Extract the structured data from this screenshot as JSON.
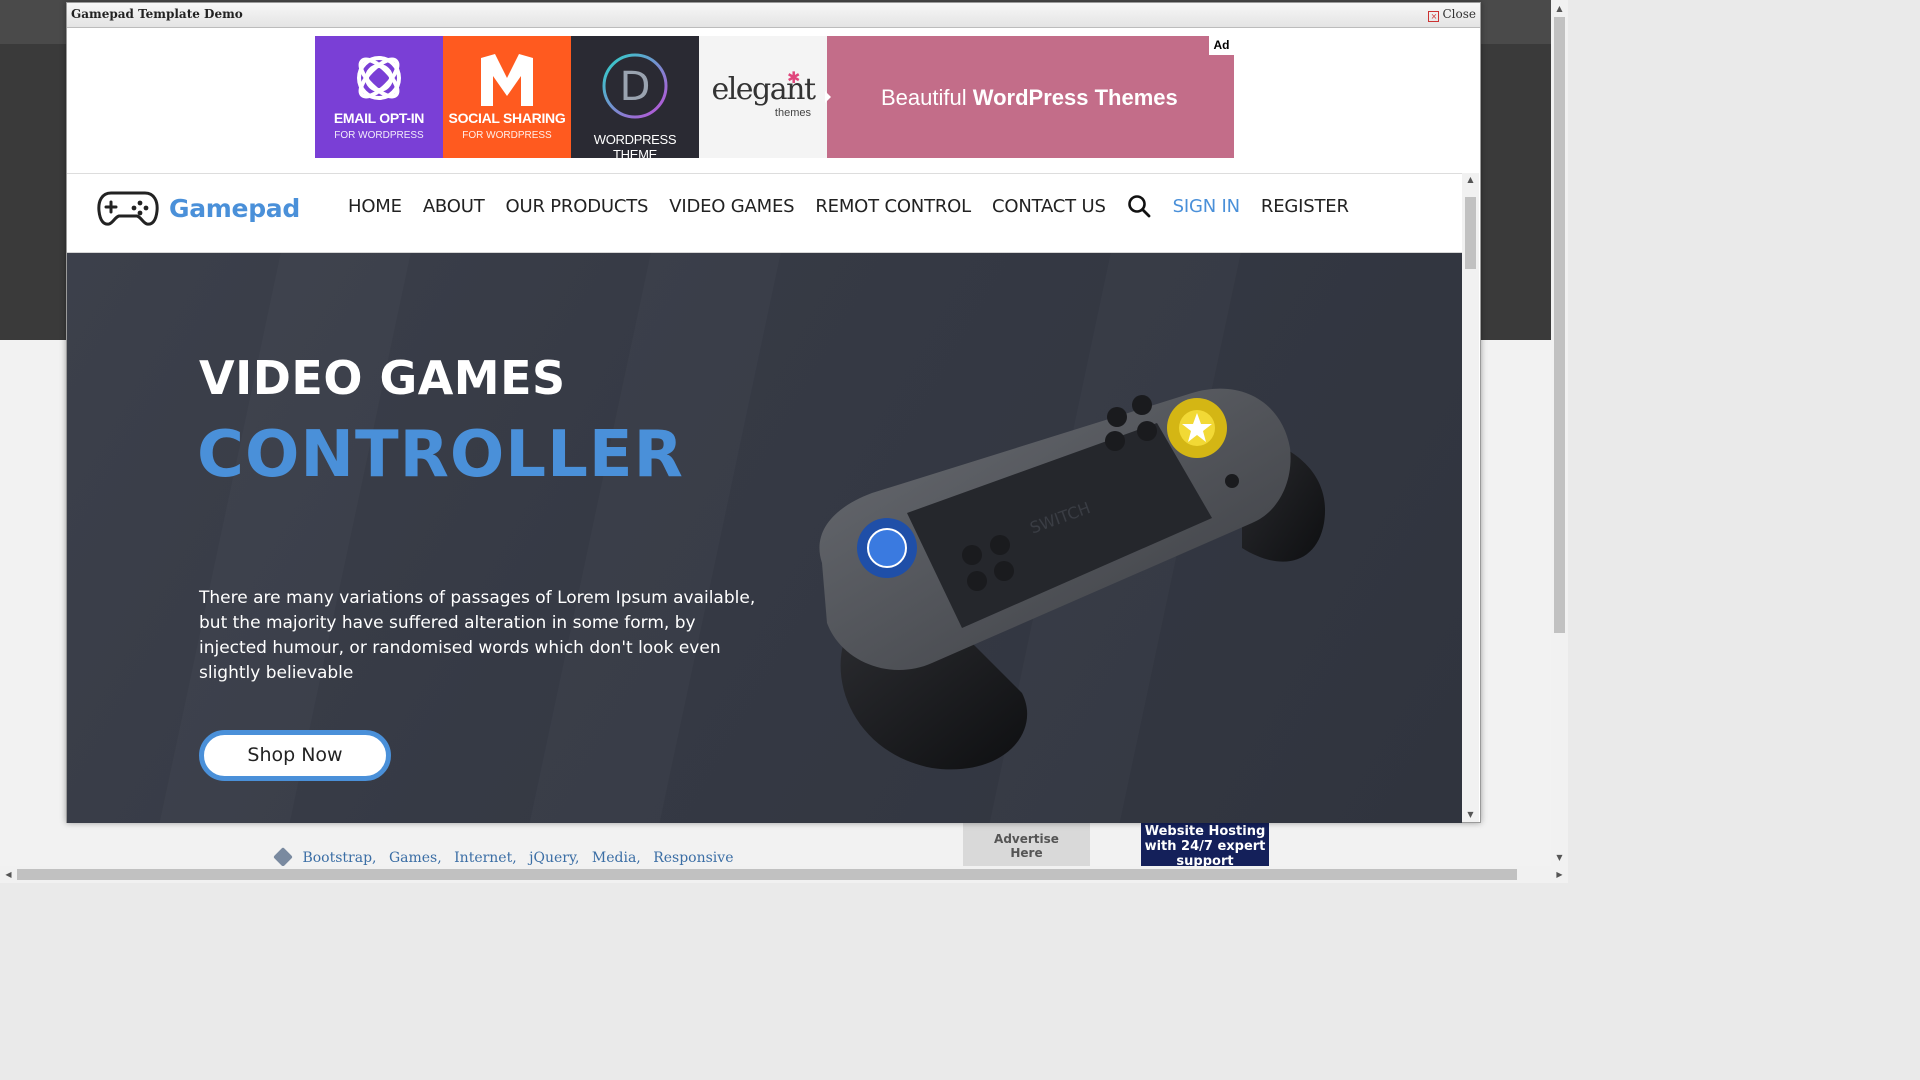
{
  "modal": {
    "title": "Gamepad Template Demo",
    "close_label": "Close"
  },
  "ad": {
    "badge": "Ad",
    "tiles": [
      {
        "line1": "EMAIL OPT-IN",
        "line2": "FOR WORDPRESS",
        "color": "#7a3fd6"
      },
      {
        "line1": "SOCIAL SHARING",
        "line2": "FOR WORDPRESS",
        "color": "#ff5a1f"
      },
      {
        "line1": "WORDPRESS THEME",
        "line2": "",
        "color": "#2a2a33"
      },
      {
        "line1": "elegant",
        "line2": "themes",
        "color": "#f4f4f4"
      }
    ],
    "message_prefix": "Beautiful ",
    "message_bold": "WordPress Themes",
    "message_color": "#c36d89"
  },
  "site": {
    "logo_text": "Gamepad",
    "accent_color": "#4a90d9",
    "nav": [
      "HOME",
      "ABOUT",
      "OUR PRODUCTS",
      "VIDEO GAMES",
      "REMOT CONTROL",
      "CONTACT US"
    ],
    "sign_in": "SIGN IN",
    "register": "REGISTER"
  },
  "hero": {
    "title_line1": "VIDEO GAMES",
    "title_line2": "CONTROLLER",
    "paragraph": "There are many variations of passages of Lorem Ipsum available, but the majority have suffered alteration in some form, by injected humour, or randomised words which don't look even slightly believable",
    "button_label": "Shop Now",
    "controller_brand": "SWITCH",
    "background_color": "#363a45"
  },
  "background_page": {
    "tags": [
      "Bootstrap,",
      "Games,",
      "Internet,",
      "jQuery,",
      "Media,",
      "Responsive"
    ],
    "advertise_line1": "Advertise",
    "advertise_line2": "Here",
    "hosting_text": "Website Hosting with 24/7 expert support"
  }
}
